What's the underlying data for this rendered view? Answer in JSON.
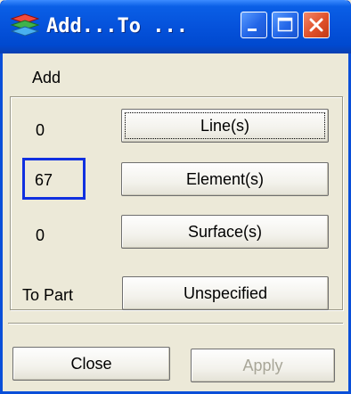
{
  "window": {
    "title": "Add...To ...",
    "icon": "layers-icon"
  },
  "titlebar_buttons": {
    "minimize_icon": "minimize-icon",
    "maximize_icon": "maximize-icon",
    "close_icon": "close-icon"
  },
  "add_section": {
    "heading": "Add",
    "rows": [
      {
        "count": "0",
        "button_label": "Line(s)"
      },
      {
        "count": "67",
        "button_label": "Element(s)"
      },
      {
        "count": "0",
        "button_label": "Surface(s)"
      }
    ]
  },
  "part_section": {
    "label": "To Part",
    "button_label": "Unspecified"
  },
  "footer": {
    "close_label": "Close",
    "apply_label": "Apply"
  },
  "colors": {
    "titlebar": "#0552DB",
    "highlight": "#1030E0",
    "dialog_bg": "#ECE9D8",
    "close_button": "#E0502A"
  }
}
